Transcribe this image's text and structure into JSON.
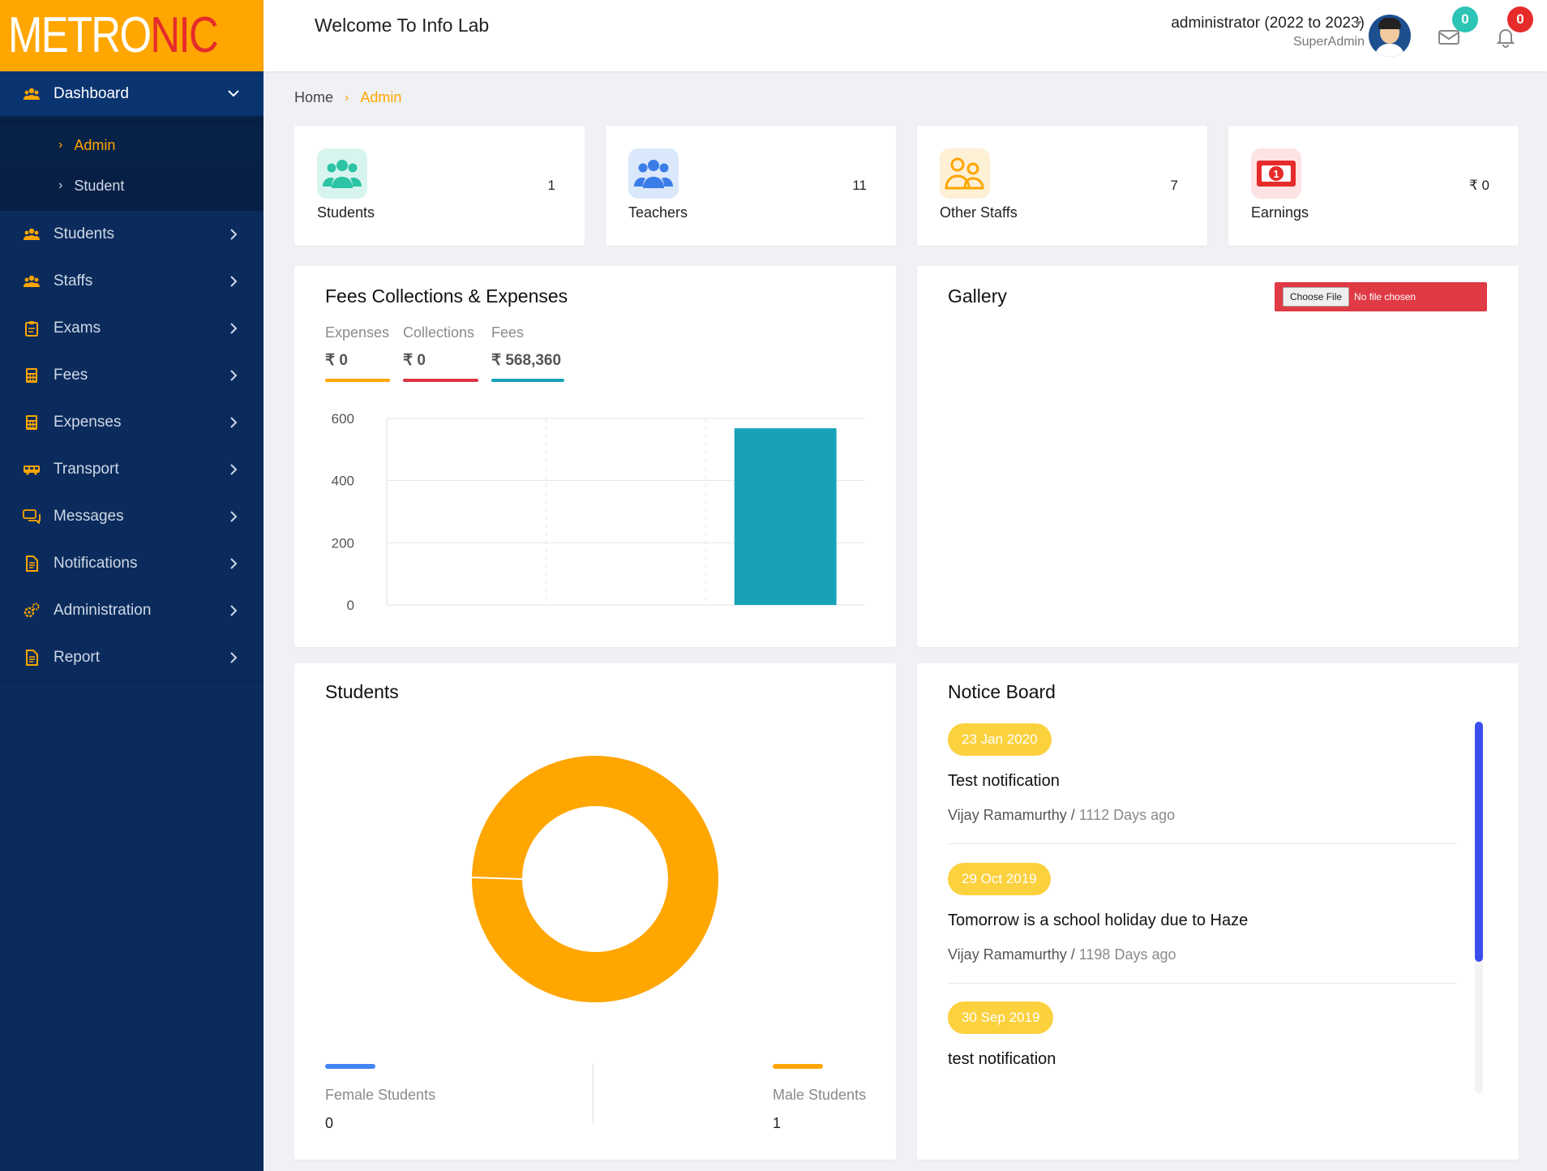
{
  "brand": {
    "logo_main": "METRO",
    "logo_accent": "NIC"
  },
  "header": {
    "welcome": "Welcome To Info Lab",
    "user_name": "administrator (2022 to 2023)",
    "user_role": "SuperAdmin",
    "mail_count": "0",
    "notification_count": "0"
  },
  "sidebar": {
    "items": [
      {
        "label": "Dashboard",
        "icon": "group-icon"
      },
      {
        "label": "Students",
        "icon": "group-icon"
      },
      {
        "label": "Staffs",
        "icon": "group-icon"
      },
      {
        "label": "Exams",
        "icon": "clipboard-icon"
      },
      {
        "label": "Fees",
        "icon": "calculator-icon"
      },
      {
        "label": "Expenses",
        "icon": "calculator-icon"
      },
      {
        "label": "Transport",
        "icon": "bus-icon"
      },
      {
        "label": "Messages",
        "icon": "chat-icon"
      },
      {
        "label": "Notifications",
        "icon": "document-icon"
      },
      {
        "label": "Administration",
        "icon": "gears-icon"
      },
      {
        "label": "Report",
        "icon": "document-icon"
      }
    ],
    "dashboard_sub": [
      {
        "label": "Admin"
      },
      {
        "label": "Student"
      }
    ]
  },
  "breadcrumb": {
    "home": "Home",
    "current": "Admin"
  },
  "stats": [
    {
      "label": "Students",
      "value": "1"
    },
    {
      "label": "Teachers",
      "value": "11"
    },
    {
      "label": "Other Staffs",
      "value": "7"
    },
    {
      "label": "Earnings",
      "value": "₹ 0"
    }
  ],
  "fees": {
    "title": "Fees Collections & Expenses",
    "legend": [
      {
        "label": "Expenses",
        "value": "₹ 0",
        "color": "#ffa600"
      },
      {
        "label": "Collections",
        "value": "₹ 0",
        "color": "#dc3545"
      },
      {
        "label": "Fees",
        "value": "₹ 568,360",
        "color": "#17a2b8"
      }
    ]
  },
  "gallery": {
    "title": "Gallery",
    "choose_file": "Choose File",
    "file_status": "No file chosen"
  },
  "students_chart": {
    "title": "Students",
    "female_label": "Female Students",
    "female_value": "0",
    "male_label": "Male Students",
    "male_value": "1",
    "female_color": "#4285f4",
    "male_color": "#ffa600"
  },
  "notice_board": {
    "title": "Notice Board",
    "notices": [
      {
        "date": "23 Jan 2020",
        "title": "Test notification",
        "author": "Vijay Ramamurthy",
        "ago": "1112 Days ago"
      },
      {
        "date": "29 Oct 2019",
        "title": "Tomorrow is a school holiday due to Haze",
        "author": "Vijay Ramamurthy",
        "ago": "1198 Days ago"
      },
      {
        "date": "30 Sep 2019",
        "title": "test notification"
      }
    ]
  },
  "chart_data": [
    {
      "type": "bar",
      "categories": [
        "Expenses",
        "Collections",
        "Fees"
      ],
      "values": [
        0,
        0,
        568.36
      ],
      "ylim": [
        0,
        600
      ],
      "yticks": [
        "0",
        "200",
        "400",
        "600"
      ],
      "grid": true,
      "colors": [
        "#ffa600",
        "#dc3545",
        "#17a2b8"
      ]
    },
    {
      "type": "pie",
      "categories": [
        "Female Students",
        "Male Students"
      ],
      "values": [
        0,
        1
      ],
      "colors": [
        "#4285f4",
        "#ffa600"
      ]
    }
  ]
}
